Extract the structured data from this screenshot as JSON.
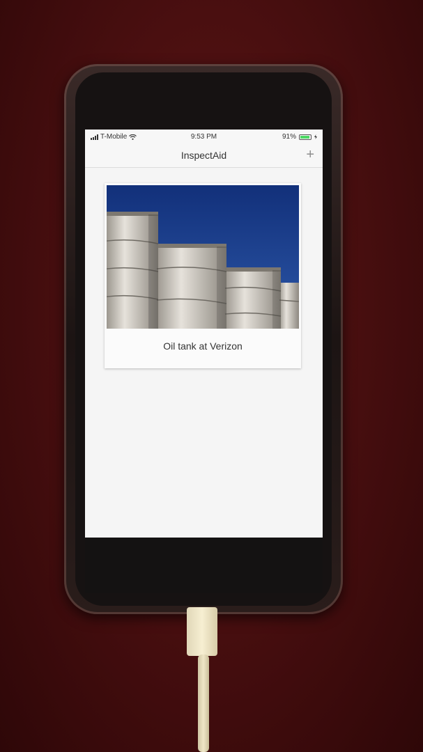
{
  "status_bar": {
    "carrier": "T-Mobile",
    "time": "9:53 PM",
    "battery": "91%",
    "battery_level": 0.91
  },
  "nav": {
    "title": "InspectAid",
    "add_label": "+"
  },
  "inspections": [
    {
      "caption": "Oil tank at Verizon"
    }
  ],
  "icons": {
    "signal": "signal-icon",
    "wifi": "wifi-icon",
    "battery": "battery-icon",
    "charging": "charging-icon",
    "add": "plus-icon"
  },
  "colors": {
    "battery_fill": "#4cd964",
    "sky": "#1d3f8a",
    "tanks": "#cfcac2",
    "background": "#4a0f10"
  }
}
